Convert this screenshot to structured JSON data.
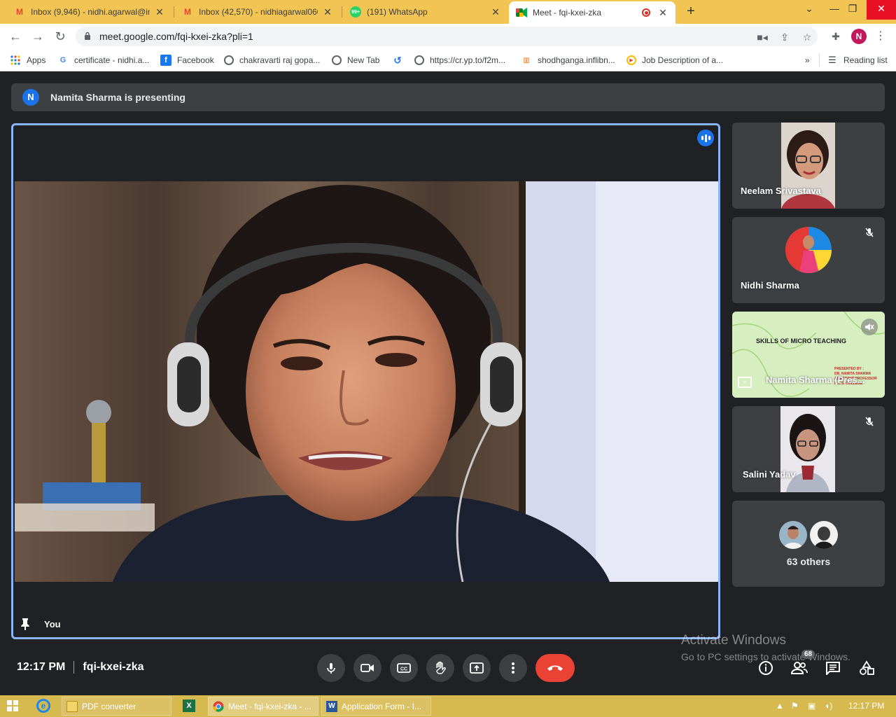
{
  "browser": {
    "tabs": [
      {
        "title": "Inbox (9,946) - nidhi.agarwal@in",
        "icon": "gmail-icon",
        "active": false
      },
      {
        "title": "Inbox (42,570) - nidhiagarwal060",
        "icon": "gmail-icon",
        "active": false
      },
      {
        "title": "(191) WhatsApp",
        "icon": "whatsapp-icon",
        "badge": "99+",
        "active": false
      },
      {
        "title": "Meet - fqi-kxei-zka",
        "icon": "meet-icon",
        "active": true
      }
    ],
    "new_tab_label": "+",
    "url": "meet.google.com/fqi-kxei-zka?pli=1",
    "profile_initial": "N",
    "bookmarks": [
      {
        "label": "Apps",
        "icon": "apps-grid-icon"
      },
      {
        "label": "certificate - nidhi.a...",
        "icon": "google-icon"
      },
      {
        "label": "Facebook",
        "icon": "facebook-icon"
      },
      {
        "label": "chakravarti raj gopa...",
        "icon": "globe-icon"
      },
      {
        "label": "New Tab",
        "icon": "globe-icon"
      },
      {
        "label": "https://cr.yp.to/f2m...",
        "icon": "globe-icon"
      },
      {
        "label": "shodhganga.inflibn...",
        "icon": "shodhganga-icon"
      },
      {
        "label": "Job Description of a...",
        "icon": "play-icon"
      }
    ],
    "bookmarks_overflow": "»",
    "reading_list": "Reading list"
  },
  "meet": {
    "presenter_initial": "N",
    "presenting_text": "Namita Sharma is presenting",
    "main_tile_label": "You",
    "participants": [
      {
        "name": "Neelam Srivastava",
        "muted": false
      },
      {
        "name": "Nidhi Sharma",
        "muted": true
      },
      {
        "name": "Namita Sharma (Pres...",
        "muted": true,
        "slide_title": "SKILLS OF MICRO TEACHING",
        "slide_presented_by": "PRESENTED BY :",
        "slide_presenter": "DR. NAMITA SHARMA",
        "slide_role": "ASSISTANT PROFESSOR",
        "slide_college": "K.C.S. COLLEGE"
      },
      {
        "name": "Salini Yadav",
        "muted": true
      }
    ],
    "others_label": "63 others",
    "time": "12:17 PM",
    "meeting_code": "fqi-kxei-zka",
    "participants_badge": "68"
  },
  "windows": {
    "activate_title": "Activate Windows",
    "activate_sub": "Go to PC settings to activate Windows.",
    "tasks": [
      {
        "label": "PDF converter",
        "icon": "folder-icon"
      },
      {
        "label": "Meet - fqi-kxei-zka - ...",
        "icon": "chrome-icon"
      },
      {
        "label": "Application Form - I...",
        "icon": "word-icon"
      }
    ],
    "clock": "12:17 PM"
  },
  "colors": {
    "accent": "#1a73e8",
    "end_call": "#ea4335",
    "tab_strip": "#f1c453",
    "tile_bg": "#3c4043",
    "meet_bg": "#202124"
  }
}
